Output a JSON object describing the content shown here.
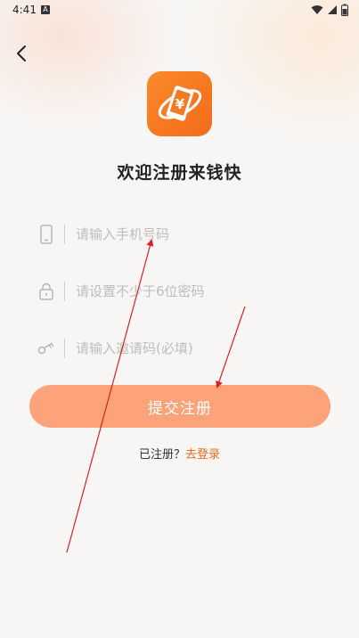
{
  "status_bar": {
    "time": "4:41",
    "notification_glyph": "A"
  },
  "navigation": {
    "back_icon": "chevron-left-icon"
  },
  "logo": {
    "icon": "money-phone-logo",
    "symbol": "¥",
    "colors": [
      "#fb8a2a",
      "#f36a1a"
    ]
  },
  "title": "欢迎注册来钱快",
  "fields": [
    {
      "icon": "phone-icon",
      "placeholder": "请输入手机号码"
    },
    {
      "icon": "lock-icon",
      "placeholder": "请设置不少于6位密码"
    },
    {
      "icon": "key-icon",
      "placeholder": "请输入邀请码(必填)"
    }
  ],
  "submit": {
    "label": "提交注册",
    "color": "#fca37a"
  },
  "login_prompt": {
    "text": "已注册？",
    "link": "去登录",
    "link_color": "#f06a1e"
  },
  "annotation_color": "#e02020"
}
